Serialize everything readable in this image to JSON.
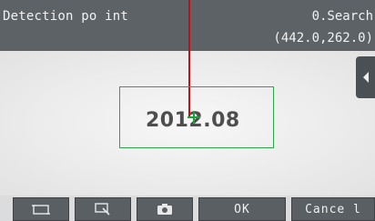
{
  "header": {
    "title": "Detection po int",
    "search_mode": "0.Search",
    "coordinates": "(442.0,262.0)"
  },
  "image": {
    "text": "2012.08"
  },
  "toolbar": {
    "ok_label": "OK",
    "cancel_label": "Cance l",
    "icons": [
      "rectangle-frame-icon",
      "region-select-icon",
      "camera-icon"
    ]
  },
  "colors": {
    "header_bg": "#5c6266",
    "marker_line": "#c0101c",
    "roi_border": "#2da44a",
    "crosshair": "#1aa33a",
    "button_bg": "#5a5f63"
  }
}
